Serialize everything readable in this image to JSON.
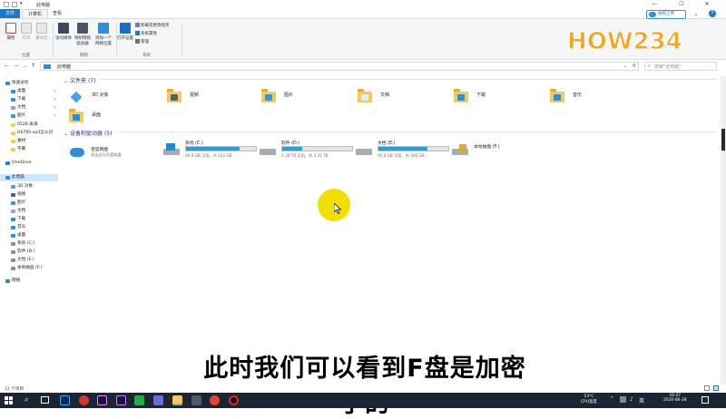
{
  "window": {
    "title": "此电脑",
    "minimize": "—",
    "maximize": "☐",
    "close": "✕"
  },
  "ribbon_tabs": [
    "文件",
    "计算机",
    "查看"
  ],
  "ribbon": {
    "buttons": [
      "属性",
      "打开",
      "重命名",
      "访问媒体",
      "映射网络驱动器",
      "添加一个网络位置",
      "打开设置"
    ],
    "small_items": [
      "卸载或更改程序",
      "系统属性",
      "管理"
    ],
    "groups": [
      "位置",
      "网络",
      "系统"
    ]
  },
  "upload_button": "拍照上传",
  "logo_text": "HOW234",
  "address": {
    "path": "此电脑",
    "search_placeholder": "搜索\"此电脑\""
  },
  "nav": {
    "items": [
      {
        "label": "快速访问",
        "color": "#2d8fd8"
      },
      {
        "label": "桌面",
        "color": "#2d8fd8"
      },
      {
        "label": "下载",
        "color": "#2d8fd8"
      },
      {
        "label": "文档",
        "color": "#9aa3ad"
      },
      {
        "label": "图片",
        "color": "#3a96d4"
      },
      {
        "label": "0528-表演",
        "color": "#f4c95d"
      },
      {
        "label": "H0795-ao3怎么切",
        "color": "#f4c95d"
      },
      {
        "label": "素材",
        "color": "#f4c95d"
      },
      {
        "label": "字幕",
        "color": "#f4c95d"
      },
      {
        "label": "OneDrive",
        "color": "#2d7bd6"
      },
      {
        "label": "此电脑",
        "color": "#2d8fd8"
      },
      {
        "label": "3D 对象",
        "color": "#4aa3e0"
      },
      {
        "label": "视频",
        "color": "#555e6a"
      },
      {
        "label": "图片",
        "color": "#3a96d4"
      },
      {
        "label": "文档",
        "color": "#9aa3ad"
      },
      {
        "label": "下载",
        "color": "#2d8fd8"
      },
      {
        "label": "音乐",
        "color": "#2d8fd8"
      },
      {
        "label": "桌面",
        "color": "#2d8fd8"
      },
      {
        "label": "系统 (C:)",
        "color": "#8a8f96"
      },
      {
        "label": "软件 (D:)",
        "color": "#8a8f96"
      },
      {
        "label": "文档 (E:)",
        "color": "#8a8f96"
      },
      {
        "label": "本地磁盘 (F:)",
        "color": "#8a8f96"
      },
      {
        "label": "网络",
        "color": "#4a7bb8"
      }
    ]
  },
  "folders_section": {
    "title": "文件夹 (7)",
    "items": [
      {
        "label": "3D 对象",
        "icon": "cube-icon",
        "color": "#4aa3e0"
      },
      {
        "label": "视频",
        "icon": "video-folder-icon",
        "color": "#555e6a"
      },
      {
        "label": "图片",
        "icon": "pictures-folder-icon",
        "color": "#3a96d4"
      },
      {
        "label": "文档",
        "icon": "documents-folder-icon",
        "color": "#e8eaec"
      },
      {
        "label": "下载",
        "icon": "downloads-folder-icon",
        "color": "#2d8fd8"
      },
      {
        "label": "音乐",
        "icon": "music-folder-icon",
        "color": "#2d8fd8"
      },
      {
        "label": "桌面",
        "icon": "desktop-folder-icon",
        "color": "#2d8fd8"
      }
    ]
  },
  "drives_section": {
    "title": "设备和驱动器 (5)",
    "items": [
      {
        "name": "百度网盘",
        "sub": "双击运行百度网盘",
        "type": "cloud"
      },
      {
        "name": "系统 (C:)",
        "space": "50.9 GB 可用，共 222 GB",
        "fraction": 0.77,
        "type": "windows"
      },
      {
        "name": "软件 (D:)",
        "space": "2.39 TB 可用，共 3.32 TB",
        "fraction": 0.28,
        "type": "hdd"
      },
      {
        "name": "文档 (E:)",
        "space": "91.0 GB 可用，共 306 GB",
        "fraction": 0.7,
        "type": "hdd"
      },
      {
        "name": "本地磁盘 (F:)",
        "type": "locked"
      }
    ]
  },
  "status_bar": {
    "count": "12 个项目"
  },
  "subtitle": "此时我们可以看到F盘是加密了的",
  "taskbar": {
    "temp": "53°C",
    "temp_label": "CPU温度",
    "time": "16:47",
    "date": "2020-06-28",
    "ime": "英"
  }
}
